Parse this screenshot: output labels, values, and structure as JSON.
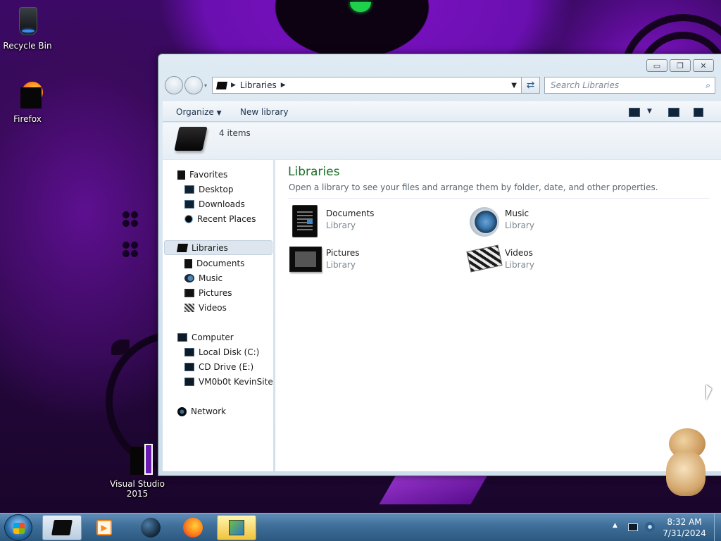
{
  "desktop": {
    "icons": [
      {
        "label": "Recycle Bin"
      },
      {
        "label": "Firefox"
      },
      {
        "label": "Visual Studio 2015"
      }
    ]
  },
  "window": {
    "address": {
      "segments": [
        "Libraries"
      ]
    },
    "search": {
      "placeholder": "Search Libraries"
    },
    "toolbar": {
      "organize_label": "Organize",
      "new_library_label": "New library"
    },
    "details": {
      "item_count": "4 items"
    },
    "nav": {
      "favorites": {
        "label": "Favorites",
        "items": [
          "Desktop",
          "Downloads",
          "Recent Places"
        ]
      },
      "libraries": {
        "label": "Libraries",
        "items": [
          "Documents",
          "Music",
          "Pictures",
          "Videos"
        ]
      },
      "computer": {
        "label": "Computer",
        "items": [
          "Local Disk (C:)",
          "CD Drive (E:)",
          "VM0b0t KevinSite"
        ]
      },
      "network": {
        "label": "Network"
      }
    },
    "content": {
      "title": "Libraries",
      "description": "Open a library to see your files and arrange them by folder, date, and other properties.",
      "libraries": [
        {
          "name": "Documents",
          "type": "Library"
        },
        {
          "name": "Music",
          "type": "Library"
        },
        {
          "name": "Pictures",
          "type": "Library"
        },
        {
          "name": "Videos",
          "type": "Library"
        }
      ]
    }
  },
  "taskbar": {
    "clock": {
      "time": "8:32 AM",
      "date": "7/31/2024"
    }
  },
  "colors": {
    "title_green": "#1d6f2a",
    "selection": "#dde6ee",
    "taskbar": "#3f6f99"
  }
}
